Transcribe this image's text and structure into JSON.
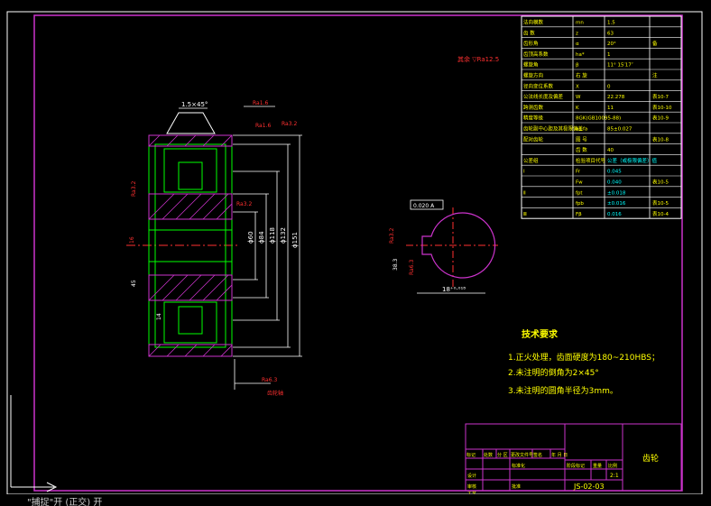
{
  "colors": {
    "background": "#000000",
    "frame": "#cc33cc",
    "outline": "#00ff00",
    "dim": "#ffffff",
    "center": "#ff3030",
    "hatch": "#cc33cc",
    "text": "#ffff00",
    "roughness": "#ff3030",
    "tolerance": "#00ffff"
  },
  "roughness_note": "其余 ▽Ra12.5",
  "drawing": {
    "labels": {
      "chamfer_top": "1.5×45°",
      "ra_top": "Ra1.6",
      "ra_top2": "Ra3.2",
      "ra_left": "Ra3.2",
      "ra_mid": "Ra3.2",
      "ra_bottom": "Ra6.3",
      "ref_bottom": "齿轮轴",
      "dims_vertical": [
        "ϕ60",
        "ϕ84",
        "ϕ118",
        "ϕ132",
        "ϕ151"
      ],
      "dim_top_small": "16",
      "dim_left": "45",
      "dim_left2": "14",
      "dim_width": "45"
    }
  },
  "hub": {
    "tolerance_frame": "0.020 A",
    "ra1": "Ra3.2",
    "ra2": "Ra6.3",
    "dim_key": "38.3",
    "dim_bore": "18⁺⁰·⁰¹⁸",
    "datum": "A"
  },
  "param_table": {
    "rows": [
      [
        "法向模数",
        "mn",
        "1.5"
      ],
      [
        "齿 数",
        "z",
        "63"
      ],
      [
        "齿形角",
        "α",
        "20°"
      ],
      [
        "齿顶高系数",
        "ha*",
        "1"
      ],
      [
        "螺旋角",
        "β",
        "11° 15′17″"
      ],
      [
        "螺旋方向",
        "右 旋",
        ""
      ],
      [
        "径向变位系数",
        "X",
        "0"
      ],
      [
        "公法线长度及偏差",
        "W",
        "22.278"
      ],
      [
        "跨测齿数",
        "K",
        "11"
      ],
      [
        "精度等级",
        "8GK(GB10095-88)",
        ""
      ],
      [
        "齿轮副中心距及其极限偏差",
        "a±fa",
        "85±0.027"
      ],
      [
        "配对齿轮",
        "图 号",
        ""
      ],
      [
        "",
        "齿 数",
        "40"
      ],
      [
        "公差组",
        "检验项目代号",
        "公差（或极限偏差）值"
      ],
      [
        "Ⅰ",
        "Fr",
        "0.045"
      ],
      [
        "",
        "Fw",
        "0.040"
      ],
      [
        "Ⅱ",
        "fpt",
        "±0.018"
      ],
      [
        "",
        "fpb",
        "±0.016"
      ],
      [
        "Ⅲ",
        "Fβ",
        "0.016"
      ]
    ],
    "notes": [
      "备",
      "注",
      "表10-7",
      "表10-10",
      "表10-9",
      "表10-8",
      "表10-5",
      "表10-5",
      "表10-4"
    ]
  },
  "tech_requirements": {
    "title": "技术要求",
    "items": [
      "1.正火处理，齿面硬度为180~210HBS；",
      "2.未注明的倒角为2×45°",
      "3.未注明的圆角半径为3mm。"
    ]
  },
  "title_block": {
    "part_name": "齿轮",
    "scale": "2:1",
    "headers": [
      "标记",
      "处数",
      "分 区",
      "更改文件号",
      "签名",
      "年 月 日"
    ],
    "labels": [
      "设计",
      "标准化",
      "阶段标记",
      "重量",
      "比例",
      "审核",
      "工艺",
      "批准"
    ],
    "drawing_no": "JS-02-03"
  },
  "command_line": {
    "prompt": "X",
    "status": "\"捕捉\"开  (正交) 开"
  }
}
